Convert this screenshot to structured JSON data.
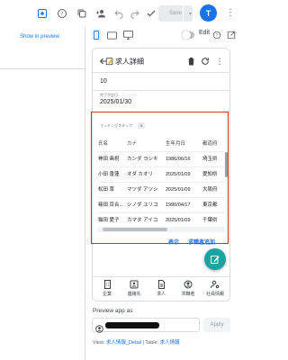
{
  "toolbar": {
    "save_label": "Save",
    "avatar_initial": "T",
    "icons": [
      "settings-icon",
      "help-icon",
      "copy-icon",
      "add-person-icon",
      "undo-icon",
      "redo-icon",
      "check-icon",
      "more-vert-icon"
    ]
  },
  "left_panel": {
    "show_in_preview": "Show in preview"
  },
  "preview_controls": {
    "edit_label": "Edit",
    "devices": [
      "phone",
      "tablet",
      "desktop"
    ]
  },
  "app": {
    "title": "求人詳細",
    "field_value_top": "10",
    "date_label": "完了予定日",
    "date_value": "2025/01/30",
    "section_label": "マッチングスタッフ",
    "section_count": "5",
    "table": {
      "columns": [
        "氏名",
        "カナ",
        "生年月日",
        "都道府"
      ],
      "rows": [
        [
          "神田 画祝",
          "カンダ ヨシキ",
          "1986/06/16",
          "埼玉県"
        ],
        [
          "小田 香蓮",
          "オダ カオリ",
          "2025/01/09",
          "愛知県"
        ],
        [
          "松田 草",
          "マツダ アツシ",
          "2025/01/09",
          "大阪府"
        ],
        [
          "篠田 百合...",
          "シノダ ユリコ",
          "1990/04/17",
          "東京都"
        ],
        [
          "猫田 愛子",
          "カマタ アイコ",
          "2025/01/09",
          "千葉県"
        ]
      ]
    },
    "actions": {
      "view": "表示",
      "add": "求職者追加"
    },
    "bottom_nav": [
      "企業",
      "連絡先",
      "求人",
      "求職者",
      "社員情報"
    ]
  },
  "preview_as": {
    "label": "Preview app as",
    "apply_label": "Apply"
  },
  "footer": {
    "view_prefix": "View:",
    "view_name": "求人情報_Detail",
    "separator": "|",
    "table_prefix": "Table:",
    "table_name": "求人情報"
  },
  "colors": {
    "accent": "#1a73e8",
    "fab": "#1ba2a3",
    "highlight_border": "#d93025"
  }
}
